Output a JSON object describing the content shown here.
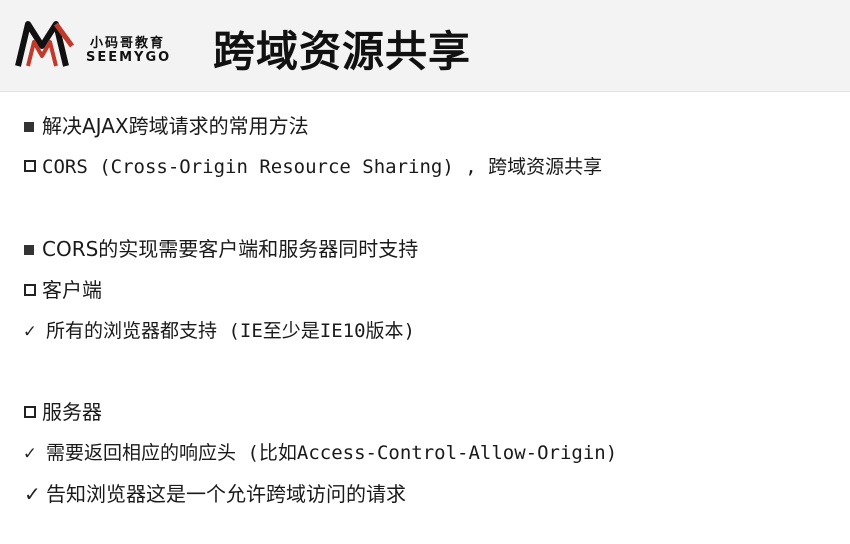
{
  "logo": {
    "icon": "seemygo-m-logo",
    "brand_cn": "小码哥教育",
    "brand_en": "SEEMYGO",
    "colors": [
      "#c0392b",
      "#111111"
    ]
  },
  "title": "跨域资源共享",
  "lines": [
    {
      "bullet": "filled-square",
      "text": "解决AJAX跨域请求的常用方法"
    },
    {
      "bullet": "open-square",
      "text": "CORS (Cross-Origin Resource Sharing) , 跨域资源共享"
    },
    {
      "bullet": "filled-square",
      "text": "CORS的实现需要客户端和服务器同时支持"
    },
    {
      "bullet": "open-square",
      "text": "客户端"
    },
    {
      "bullet": "check",
      "text": "所有的浏览器都支持 (IE至少是IE10版本)"
    },
    {
      "bullet": "open-square",
      "text": "服务器"
    },
    {
      "bullet": "check",
      "text": "需要返回相应的响应头 (比如Access-Control-Allow-Origin)"
    },
    {
      "bullet": "check",
      "text": "告知浏览器这是一个允许跨域访问的请求"
    }
  ],
  "check_glyph": "✓"
}
